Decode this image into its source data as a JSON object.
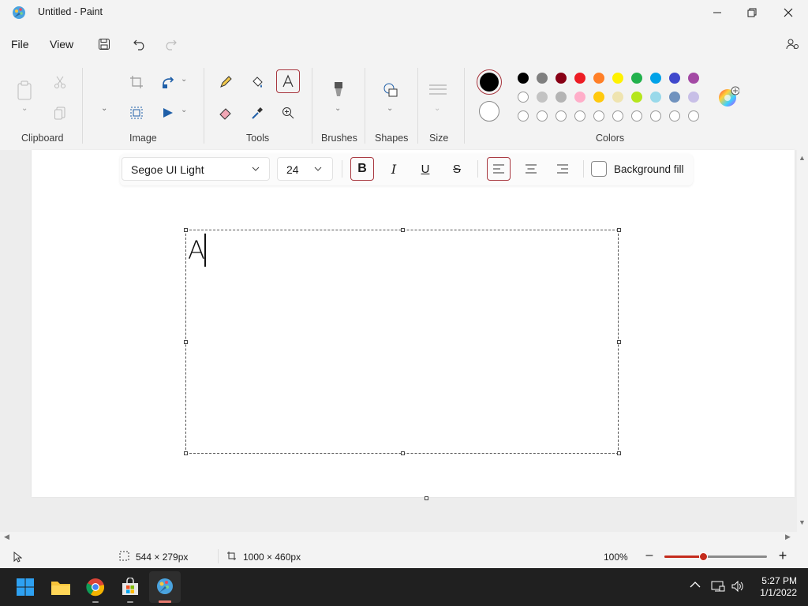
{
  "window": {
    "title": "Untitled - Paint"
  },
  "menu": {
    "file": "File",
    "view": "View"
  },
  "ribbon": {
    "groups": {
      "clipboard": "Clipboard",
      "image": "Image",
      "tools": "Tools",
      "brushes": "Brushes",
      "shapes": "Shapes",
      "size": "Size",
      "colors": "Colors"
    },
    "palette_row1": [
      "#000000",
      "#7f7f7f",
      "#880015",
      "#ed1c24",
      "#ff7f27",
      "#fff200",
      "#22b14c",
      "#00a2e8",
      "#3f48cc",
      "#a349a4"
    ],
    "palette_row2": [
      "#ffffff",
      "#c3c3c3",
      "#b4b4b4",
      "#ffaec9",
      "#ffc90e",
      "#efe4b0",
      "#b5e61d",
      "#99d9ea",
      "#7092be",
      "#c8bfe7"
    ],
    "primary_color": "#000000",
    "secondary_color": "#ffffff"
  },
  "text_toolbar": {
    "font": "Segoe UI Light",
    "size": "24",
    "bold": true,
    "align": "left",
    "background_fill_label": "Background fill"
  },
  "canvas": {
    "typed_text": "A"
  },
  "status": {
    "selection_size": "544 × 279px",
    "canvas_size": "1000 × 460px",
    "zoom": "100%",
    "zoom_level": 0.5
  },
  "taskbar": {
    "time": "5:27 PM",
    "date": "1/1/2022"
  }
}
